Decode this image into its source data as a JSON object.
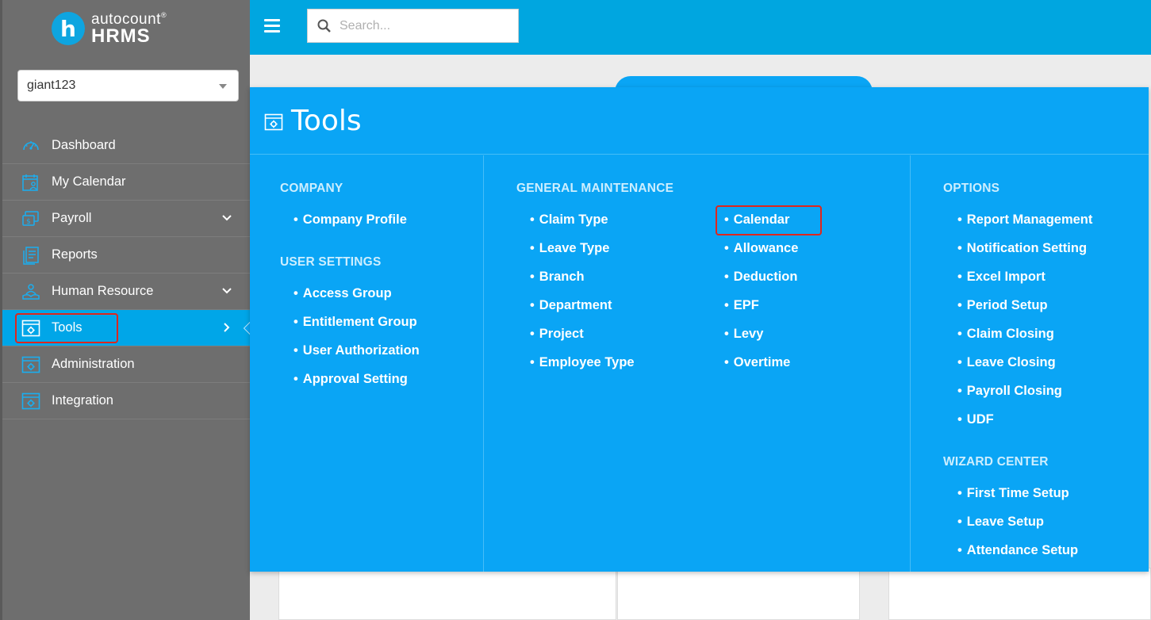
{
  "app": {
    "logo_top": "autocount",
    "logo_bottom": "HRMS",
    "logo_badge": "h"
  },
  "company_select": {
    "value": "giant123"
  },
  "search": {
    "placeholder": "Search..."
  },
  "sidebar": {
    "items": [
      {
        "label": "Dashboard",
        "icon": "dashboard-gauge-icon"
      },
      {
        "label": "My Calendar",
        "icon": "calendar-user-icon"
      },
      {
        "label": "Payroll",
        "icon": "payroll-icon",
        "has_children": true
      },
      {
        "label": "Reports",
        "icon": "report-document-icon"
      },
      {
        "label": "Human Resource",
        "icon": "human-resource-icon",
        "has_children": true
      },
      {
        "label": "Tools",
        "icon": "tools-window-gear-icon",
        "active": true
      },
      {
        "label": "Administration",
        "icon": "administration-window-gear-icon"
      },
      {
        "label": "Integration",
        "icon": "integration-window-gear-icon"
      }
    ]
  },
  "panel": {
    "title": "Tools",
    "company": {
      "title": "COMPANY",
      "links": [
        "Company Profile"
      ]
    },
    "user_settings": {
      "title": "USER SETTINGS",
      "links": [
        "Access Group",
        "Entitlement Group",
        "User Authorization",
        "Approval Setting"
      ]
    },
    "general_maintenance": {
      "title": "GENERAL MAINTENANCE",
      "col1": [
        "Claim Type",
        "Leave Type",
        "Branch",
        "Department",
        "Project",
        "Employee Type"
      ],
      "col2": [
        "Calendar",
        "Allowance",
        "Deduction",
        "EPF",
        "Levy",
        "Overtime"
      ]
    },
    "options": {
      "title": "OPTIONS",
      "links": [
        "Report Management",
        "Notification Setting",
        "Excel Import",
        "Period Setup",
        "Claim Closing",
        "Leave Closing",
        "Payroll Closing",
        "UDF"
      ]
    },
    "wizard_center": {
      "title": "WIZARD CENTER",
      "links": [
        "First Time Setup",
        "Leave Setup",
        "Attendance Setup"
      ]
    }
  },
  "colors": {
    "sidebar_bg": "#6e6e6e",
    "accent": "#00a6e0",
    "panel_bg": "#0aa5f5",
    "highlight_outline": "#e0261c"
  }
}
